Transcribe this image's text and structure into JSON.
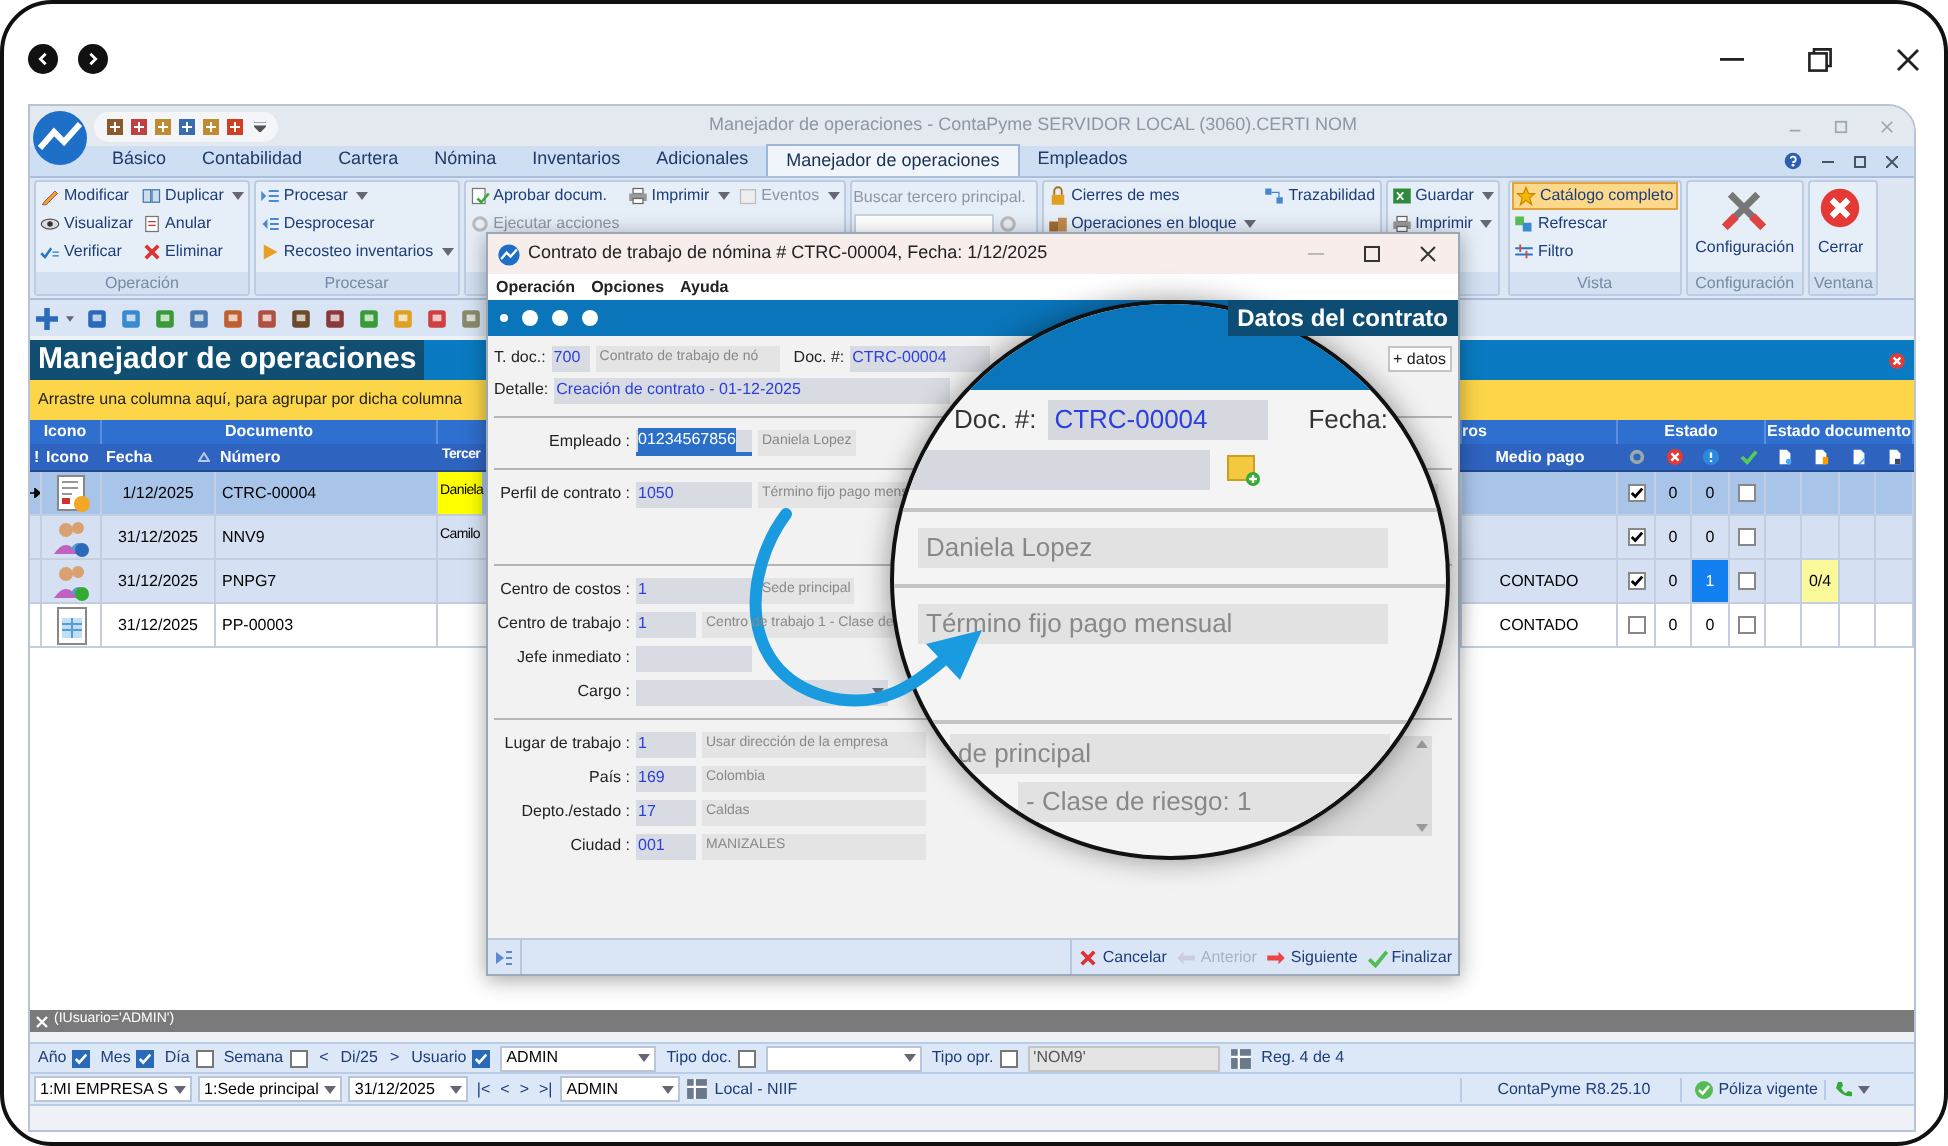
{
  "app": {
    "title": "Manejador de operaciones - ContaPyme SERVIDOR LOCAL (3060).CERTI NOM"
  },
  "tabs": [
    {
      "label": "Básico",
      "selected": false
    },
    {
      "label": "Contabilidad",
      "selected": false
    },
    {
      "label": "Cartera",
      "selected": false
    },
    {
      "label": "Nómina",
      "selected": false
    },
    {
      "label": "Inventarios",
      "selected": false
    },
    {
      "label": "Adicionales",
      "selected": false
    },
    {
      "label": "Manejador de operaciones",
      "selected": true
    },
    {
      "label": "Empleados",
      "selected": false
    }
  ],
  "ribbon": {
    "left": [
      {
        "label": "Operación",
        "columns": [
          [
            {
              "label": "Modificar",
              "kind": "edit",
              "dropdown": false,
              "disabled": false
            },
            {
              "label": "Visualizar",
              "kind": "view",
              "dropdown": false,
              "disabled": false
            },
            {
              "label": "Verificar",
              "kind": "verify",
              "dropdown": false,
              "disabled": false
            }
          ],
          [
            {
              "label": "Duplicar",
              "kind": "duplicate",
              "dropdown": true,
              "disabled": false
            },
            {
              "label": "Anular",
              "kind": "void",
              "dropdown": false,
              "disabled": false
            },
            {
              "label": "Eliminar",
              "kind": "delete",
              "dropdown": false,
              "disabled": false
            }
          ]
        ]
      },
      {
        "label": "Procesar",
        "columns": [
          [
            {
              "label": "Procesar",
              "kind": "process",
              "dropdown": true,
              "disabled": false
            },
            {
              "label": "Desprocesar",
              "kind": "unprocess",
              "dropdown": false,
              "disabled": false
            },
            {
              "label": "Recosteo inventarios",
              "kind": "recost",
              "dropdown": true,
              "disabled": false
            }
          ]
        ]
      },
      {
        "columns": [
          [
            {
              "label": "Aprobar docum.",
              "kind": "approve",
              "dropdown": false,
              "disabled": false
            },
            {
              "label": "Ejecutar acciones",
              "kind": "run",
              "dropdown": false,
              "disabled": true
            }
          ],
          [
            {
              "label": "Imprimir",
              "kind": "print",
              "dropdown": true,
              "disabled": false
            }
          ],
          [
            {
              "label": "Eventos",
              "kind": "events",
              "dropdown": true,
              "disabled": true
            }
          ]
        ]
      },
      {
        "search": {
          "label": "Buscar tercero principal."
        }
      },
      {
        "columns": [
          [
            {
              "label": "Cierres de mes",
              "kind": "lock",
              "dropdown": false,
              "disabled": false
            },
            {
              "label": "Operaciones en bloque",
              "kind": "bulk",
              "dropdown": true,
              "disabled": false
            }
          ],
          [
            {
              "label": "Trazabilidad",
              "kind": "trace",
              "dropdown": false,
              "disabled": false
            }
          ]
        ]
      },
      {
        "columns": [
          [
            {
              "label": "Guardar",
              "kind": "excel",
              "dropdown": true,
              "disabled": false
            },
            {
              "label": "Imprimir",
              "kind": "print",
              "dropdown": true,
              "disabled": false
            }
          ]
        ]
      }
    ],
    "right": [
      {
        "label": "Vista",
        "columns": [
          [
            {
              "label": "Catálogo completo",
              "kind": "star",
              "dropdown": false,
              "on": true
            },
            {
              "label": "Refrescar",
              "kind": "refresh",
              "dropdown": false,
              "on": false
            },
            {
              "label": "Filtro",
              "kind": "filter",
              "dropdown": false,
              "on": false
            }
          ]
        ]
      },
      {
        "label": "Configuración",
        "large": {
          "label": "Configuración",
          "kind": "tools"
        }
      },
      {
        "label": "Ventana",
        "large": {
          "label": "Cerrar",
          "kind": "close"
        }
      }
    ]
  },
  "panel": {
    "title": "Manejador de operaciones",
    "group_hint": "Arrastre una columna aquí, para agrupar por dicha columna"
  },
  "table": {
    "column_groups": [
      {
        "label": "Icono"
      },
      {
        "label": "Documento"
      },
      {
        "label": "ros"
      },
      {
        "label": "Estado"
      },
      {
        "label": "Estado documento"
      }
    ],
    "columns": [
      {
        "label": "!"
      },
      {
        "label": "Icono",
        "sorted": false
      },
      {
        "label": "Fecha",
        "sorted": true
      },
      {
        "label": "Número",
        "sorted": false
      },
      {
        "label": "Tercer"
      },
      {
        "label": "Medio pago",
        "sorted": false
      }
    ],
    "rows": [
      {
        "kind": "contract",
        "selected": true,
        "date": "1/12/2025",
        "number": "CTRC-00004",
        "third_party": "Daniela",
        "third_party_highlighted": true,
        "processed": true,
        "errors": "0",
        "warnings": "0",
        "warnings_flagged": false,
        "approved": false
      },
      {
        "kind": "news",
        "selected": false,
        "date": "31/12/2025",
        "number": "NNV9",
        "third_party": "Camilo",
        "third_party_highlighted": false,
        "processed": true,
        "errors": "0",
        "warnings": "0",
        "warnings_flagged": false,
        "approved": false
      },
      {
        "kind": "payment",
        "selected": false,
        "date": "31/12/2025",
        "number": "PNPG7",
        "payment": "CONTADO",
        "processed": true,
        "errors": "0",
        "warnings": "1",
        "warnings_flagged": true,
        "approved": false,
        "doc_status": "0/4"
      },
      {
        "kind": "sheet",
        "selected": false,
        "date": "31/12/2025",
        "number": "PP-00003",
        "payment": "CONTADO",
        "processed": false,
        "errors": "0",
        "warnings": "0",
        "warnings_flagged": false,
        "approved": false
      }
    ]
  },
  "filter_expression": "(IUsuario='ADMIN')",
  "filters": [
    {
      "kind": "check",
      "label": "Año",
      "checked": true
    },
    {
      "kind": "check",
      "label": "Mes",
      "checked": true
    },
    {
      "kind": "check",
      "label": "Día",
      "checked": false
    },
    {
      "kind": "check",
      "label": "Semana",
      "checked": false
    },
    {
      "kind": "nav",
      "label": "<"
    },
    {
      "kind": "text",
      "label": "Di/25"
    },
    {
      "kind": "nav",
      "label": ">"
    },
    {
      "kind": "check",
      "label": "Usuario",
      "checked": true
    },
    {
      "kind": "select",
      "value": "ADMIN"
    },
    {
      "kind": "check",
      "label": "Tipo doc.",
      "checked": false
    },
    {
      "kind": "select"
    },
    {
      "kind": "check",
      "label": "Tipo opr.",
      "checked": false
    },
    {
      "kind": "field",
      "value": "'NOM9'"
    },
    {
      "kind": "icon"
    },
    {
      "kind": "text",
      "label": "Reg. 4 de 4"
    }
  ],
  "status_bar": {
    "items": [
      {
        "kind": "select",
        "value": "1:MI EMPRESA S"
      },
      {
        "kind": "select",
        "value": "1:Sede principal"
      },
      {
        "kind": "select",
        "value": "31/12/2025"
      },
      {
        "kind": "nav",
        "label": "|<"
      },
      {
        "kind": "nav",
        "label": "<"
      },
      {
        "kind": "nav",
        "label": ">"
      },
      {
        "kind": "nav",
        "label": ">|"
      },
      {
        "kind": "select",
        "value": "ADMIN"
      },
      {
        "kind": "icon"
      },
      {
        "kind": "text",
        "label": "Local - NIIF"
      }
    ],
    "version": "ContaPyme R8.25.10",
    "policy": "Póliza vigente"
  },
  "dialog": {
    "title": "Contrato de trabajo de nómina # CTRC-00004, Fecha: 1/12/2025",
    "menu": [
      "Operación",
      "Opciones",
      "Ayuda"
    ],
    "steps": [
      {
        "selected": true
      },
      {
        "selected": false
      },
      {
        "selected": false
      },
      {
        "selected": false
      }
    ],
    "step_title": "Datos del contrato",
    "doc_type": {
      "label": "T. doc.:",
      "code": "700",
      "name": "Contrato de trabajo de nó"
    },
    "doc_number": {
      "label": "Doc. #:",
      "value": "CTRC-00004"
    },
    "more_button": "+ datos",
    "detail": {
      "label": "Detalle:",
      "value": "Creación de contrato - 01-12-2025"
    },
    "sections": [
      [
        {
          "kind": "lookup",
          "label": "Empleado :",
          "code": "01234567856",
          "name": "Daniela Lopez",
          "focused": true
        }
      ],
      [
        {
          "kind": "lookup",
          "label": "Perfil de contrato :",
          "code": "1050",
          "name": "Término fijo pago mens",
          "focused": false
        }
      ],
      [
        {
          "kind": "lookup",
          "label": "Centro de costos :",
          "code": "1",
          "name": "Sede principal",
          "focused": false
        },
        {
          "kind": "lookup",
          "label": "Centro de trabajo :",
          "code": "1",
          "name": "Centro de trabajo 1 - Clase de",
          "focused": false
        },
        {
          "kind": "lookup",
          "label": "Jefe inmediato :",
          "focused": false
        },
        {
          "kind": "select",
          "label": "Cargo :"
        }
      ],
      [
        {
          "kind": "lookup",
          "label": "Lugar de trabajo :",
          "code": "1",
          "name": "Usar dirección de la empresa",
          "focused": false
        },
        {
          "kind": "lookup",
          "label": "País :",
          "code": "169",
          "name": "Colombia",
          "focused": false
        },
        {
          "kind": "lookup",
          "label": "Depto./estado :",
          "code": "17",
          "name": "Caldas",
          "focused": false
        },
        {
          "kind": "lookup",
          "label": "Ciudad :",
          "code": "001",
          "name": "MANIZALES",
          "focused": false
        }
      ]
    ],
    "buttons": [
      {
        "label": "Cancelar",
        "kind": "cancel",
        "disabled": false
      },
      {
        "label": "Anterior",
        "kind": "back",
        "disabled": true
      },
      {
        "label": "Siguiente",
        "kind": "next",
        "disabled": false
      },
      {
        "label": "Finalizar",
        "kind": "finish",
        "disabled": false
      }
    ]
  },
  "magnifier": {
    "doc_label": "Doc. #:",
    "doc_value": "CTRC-00004",
    "date_label": "Fecha:",
    "employee": "Daniela Lopez",
    "profile": "Término fijo pago mensual",
    "cost_center": "de principal",
    "work_center": "- Clase de riesgo: 1"
  }
}
